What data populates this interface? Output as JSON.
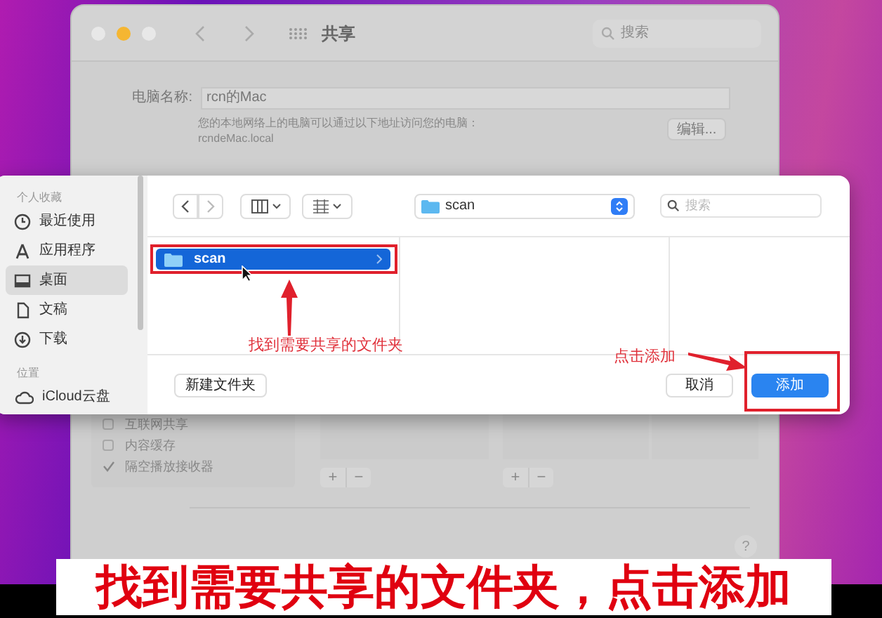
{
  "background_window": {
    "title": "共享",
    "search_placeholder": "搜索",
    "computer_name_label": "电脑名称:",
    "computer_name": "rcn的Mac",
    "address_note": "您的本地网络上的电脑可以通过以下地址访问您的电脑：",
    "address": "rcndeMac.local",
    "edit_button": "编辑...",
    "services": [
      {
        "name": "互联网共享",
        "checked": false
      },
      {
        "name": "内容缓存",
        "checked": false
      },
      {
        "name": "隔空播放接收器",
        "checked": true
      }
    ],
    "add_button": "+",
    "remove_button": "−",
    "help_button": "?"
  },
  "dialog": {
    "sidebar": [
      {
        "heading": "个人收藏",
        "items": [
          {
            "label": "最近使用",
            "kind": "clock",
            "selected": false
          },
          {
            "label": "应用程序",
            "kind": "apps",
            "selected": false
          },
          {
            "label": "桌面",
            "kind": "desktop",
            "selected": true
          },
          {
            "label": "文稿",
            "kind": "document",
            "selected": false
          },
          {
            "label": "下载",
            "kind": "download",
            "selected": false
          }
        ]
      },
      {
        "heading": "位置",
        "items": [
          {
            "label": "iCloud云盘",
            "kind": "cloud",
            "selected": false
          }
        ]
      }
    ],
    "location": "scan",
    "search_placeholder": "搜索",
    "folders": [
      {
        "name": "scan",
        "selected": true
      }
    ],
    "new_folder_button": "新建文件夹",
    "cancel_button": "取消",
    "add_button": "添加"
  },
  "annotations": [
    {
      "text": "找到需要共享的文件夹"
    },
    {
      "text": "点击添加"
    }
  ],
  "caption": "找到需要共享的文件夹，点击添加"
}
